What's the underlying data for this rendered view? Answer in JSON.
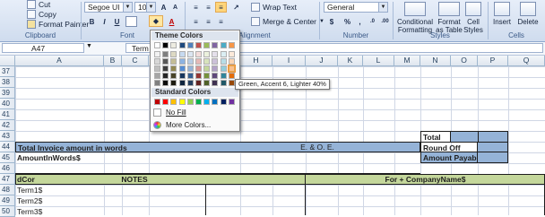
{
  "ribbon": {
    "clipboard": {
      "cut": "Cut",
      "copy": "Copy",
      "format_painter": "Format Painter",
      "group": "Clipboard"
    },
    "font": {
      "name": "Segoe UI",
      "size": "10",
      "group": "Font"
    },
    "alignment": {
      "wrap_text": "Wrap Text",
      "merge_center": "Merge & Center",
      "group": "Alignment"
    },
    "number": {
      "format": "General",
      "group": "Number"
    },
    "styles": {
      "conditional_formatting": "Conditional Formatting",
      "format_as_table": "Format as Table",
      "cell_styles": "Cell Styles",
      "group": "Styles"
    },
    "cells": {
      "insert": "Insert",
      "delete": "Delete",
      "group": "Cells"
    }
  },
  "formula_bar": {
    "name_box": "A47",
    "content": "Term"
  },
  "columns": [
    "A",
    "B",
    "C",
    "D",
    "H",
    "I",
    "J",
    "K",
    "L",
    "M",
    "N",
    "O",
    "P",
    "Q"
  ],
  "rows": [
    "37",
    "38",
    "39",
    "40",
    "41",
    "42",
    "43",
    "44",
    "45",
    "46",
    "47",
    "48",
    "49",
    "50"
  ],
  "cells": {
    "total": "Total",
    "total_invoice_words": "Total Invoice amount in words",
    "eoe": "E. & O. E.",
    "round_off": "Round Off",
    "amount_in_words": "AmountInWords$",
    "amount_payable": "Amount Payable",
    "row47_a": "dCor",
    "notes": "NOTES",
    "for_company": "For + CompanyName$",
    "term1": "Term1$",
    "term2": "Term2$",
    "term3": "Term3$"
  },
  "color_menu": {
    "theme_colors": "Theme Colors",
    "standard_colors": "Standard Colors",
    "no_fill": "No Fill",
    "more_colors": "More Colors...",
    "tooltip": "Green, Accent 6, Lighter 40%",
    "theme_top": [
      "#ffffff",
      "#000000",
      "#eeece1",
      "#1f497d",
      "#4f81bd",
      "#c0504d",
      "#9bbb59",
      "#8064a2",
      "#4bacc6",
      "#f79646"
    ],
    "theme_shades": [
      [
        "#f2f2f2",
        "#7f7f7f",
        "#ddd9c3",
        "#c6d9f0",
        "#dbe5f1",
        "#f2dcdb",
        "#ebf1dd",
        "#e5e0ec",
        "#dbeef3",
        "#fdeada"
      ],
      [
        "#d8d8d8",
        "#595959",
        "#c4bd97",
        "#8db3e2",
        "#b8cce4",
        "#e5b9b7",
        "#d7e3bc",
        "#ccc1d9",
        "#b7dde8",
        "#fbd5b5"
      ],
      [
        "#bfbfbf",
        "#3f3f3f",
        "#938953",
        "#548dd4",
        "#95b3d7",
        "#d99694",
        "#c3d69b",
        "#b2a2c7",
        "#92cddc",
        "#fac08f"
      ],
      [
        "#a5a5a5",
        "#262626",
        "#494429",
        "#17365d",
        "#366092",
        "#953734",
        "#76923c",
        "#5f497a",
        "#31859b",
        "#e36c09"
      ],
      [
        "#7f7f7f",
        "#0c0c0c",
        "#1d1b10",
        "#0f243e",
        "#244061",
        "#632423",
        "#4f6128",
        "#3f3151",
        "#205867",
        "#974806"
      ]
    ],
    "standard": [
      "#c00000",
      "#ff0000",
      "#ffc000",
      "#ffff00",
      "#92d050",
      "#00b050",
      "#00b0f0",
      "#0070c0",
      "#002060",
      "#7030a0"
    ]
  }
}
